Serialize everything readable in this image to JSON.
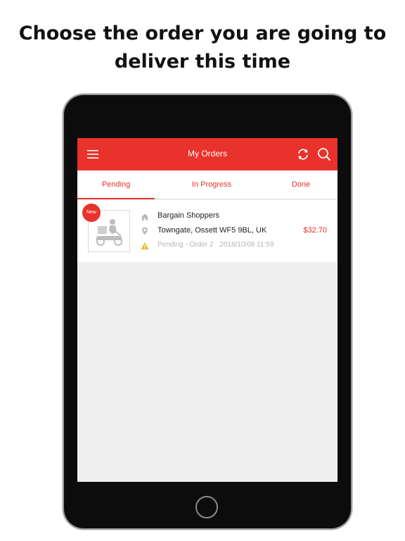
{
  "headline": {
    "line1": "Choose the order you are going to",
    "line2": "deliver this time"
  },
  "appbar": {
    "title": "My Orders",
    "icons": [
      "menu-icon",
      "refresh-icon",
      "search-icon"
    ],
    "color": "#e8322b"
  },
  "tabs": [
    {
      "label": "Pending",
      "active": true
    },
    {
      "label": "In Progress",
      "active": false
    },
    {
      "label": "Done",
      "active": false
    }
  ],
  "orders": [
    {
      "badge": "New",
      "store": "Bargain Shoppers",
      "address": "Towngate, Ossett WF5 9BL, UK",
      "price": "$32.70",
      "status": "Pending - Order 2",
      "datetime": "2018/10/08 11:59",
      "icons": [
        "store-icon",
        "location-pin-icon",
        "warning-icon",
        "delivery-scooter-icon"
      ]
    }
  ]
}
